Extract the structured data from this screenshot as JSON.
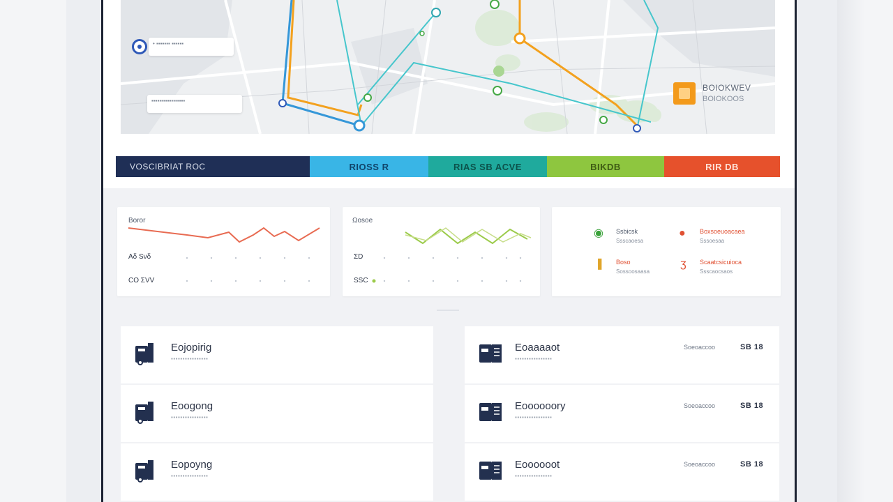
{
  "map": {
    "card1_text": "•  ▪▪▪▪▪▪▪ ▪▪▪▪▪▪",
    "card2_text": "▪▪▪▪▪▪▪▪▪▪▪▪▪▪▪▪▪",
    "legend_line1": "BOIOKWEV",
    "legend_line2": "BOIOKOOS"
  },
  "status_band": {
    "segments": [
      "VOSCIBRIAT ROC",
      "RIOSS R",
      "RIAS SB ACVE",
      "BIKDB",
      "RIR DB"
    ]
  },
  "charts": {
    "chart1": {
      "title": "Boror",
      "row1_label": "Aδ Sνδ",
      "row2_label": "CO ΣVV"
    },
    "chart2": {
      "title": "Ωosoe",
      "row1_label": "ΣD",
      "row2_label": "SSC"
    },
    "legend": [
      {
        "icon": "leaf-pin-icon",
        "label": "Ssbicsk",
        "sub": "Ssscaoesa",
        "color": "#3aa23a"
      },
      {
        "icon": "location-pin-icon",
        "label": "Boxsoeuoacaea",
        "sub": "Sssoesaa",
        "color": "#e05133"
      },
      {
        "icon": "lightbulb-icon",
        "label": "Boso",
        "sub": "Sossoosaasa",
        "color": "#e0a52a"
      },
      {
        "icon": "temperature-icon",
        "label": "Scaatcsicuioca",
        "sub": "Ssscaocsaos",
        "color": "#e05133"
      }
    ]
  },
  "list_left": [
    {
      "title": "Eojopirig",
      "sub": "▪▪▪▪▪▪▪▪▪▪▪▪▪▪▪▪"
    },
    {
      "title": "Eoogong",
      "sub": "▪▪▪▪▪▪▪▪▪▪▪▪▪▪▪▪"
    },
    {
      "title": "Eopoyng",
      "sub": "▪▪▪▪▪▪▪▪▪▪▪▪▪▪▪▪"
    }
  ],
  "list_right": [
    {
      "title": "Eoaaaaot",
      "sub": "▪▪▪▪▪▪▪▪▪▪▪▪▪▪▪▪",
      "meta": "Soeoaccoo",
      "value": "SB 18"
    },
    {
      "title": "Eoooooory",
      "sub": "▪▪▪▪▪▪▪▪▪▪▪▪▪▪▪▪",
      "meta": "Soeoaccoo",
      "value": "SB 18"
    },
    {
      "title": "Eoooooot",
      "sub": "▪▪▪▪▪▪▪▪▪▪▪▪▪▪▪▪",
      "meta": "Soeoaccoo",
      "value": "SB 18"
    }
  ]
}
